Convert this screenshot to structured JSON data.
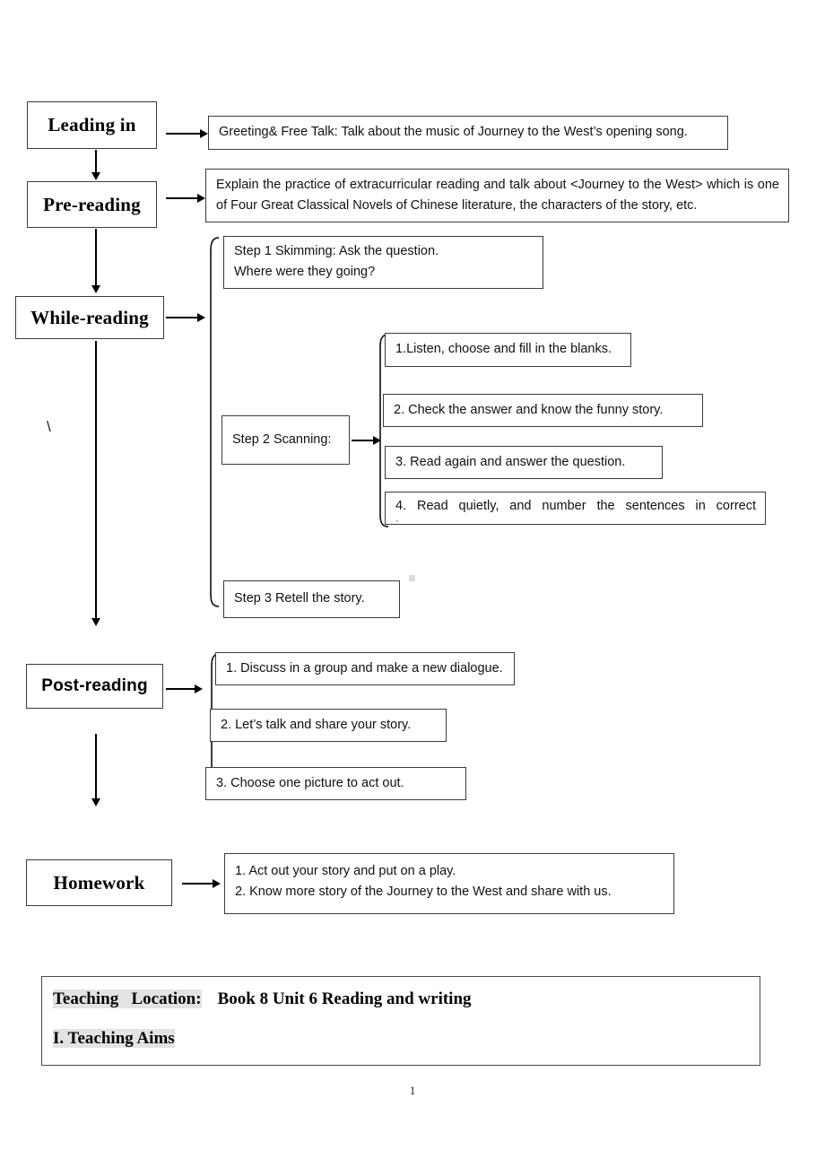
{
  "document": {
    "page_number": "1",
    "stray_mark": "\\"
  },
  "flow": {
    "stages": [
      {
        "id": "leading-in",
        "label": "Leading in"
      },
      {
        "id": "pre-reading",
        "label": "Pre-reading"
      },
      {
        "id": "while-reading",
        "label": "While-reading"
      },
      {
        "id": "post-reading",
        "label": "Post-reading"
      },
      {
        "id": "homework",
        "label": "Homework"
      }
    ],
    "leading_in": {
      "content": "Greeting& Free Talk: Talk about the music of Journey to the West’s opening song."
    },
    "pre_reading": {
      "content": "Explain the practice of extracurricular reading and talk about <Journey to the West> which is one of Four Great Classical Novels of Chinese literature, the characters of the story, etc."
    },
    "while_reading": {
      "step1": {
        "line1": "Step 1 Skimming: Ask the question.",
        "line2": "Where were they going?"
      },
      "step2": {
        "label": "Step 2 Scanning:",
        "items": [
          "1.Listen, choose and fill in the blanks.",
          "2. Check the answer and know the funny story.",
          "3. Read again and answer the question.",
          "4. Read quietly, and number the  sentences in correct"
        ],
        "item4_clipped_line": "·"
      },
      "step3": {
        "label": "Step 3 Retell the story."
      }
    },
    "post_reading": {
      "items": [
        "1. Discuss in a group and make a new dialogue.",
        "2. Let’s talk and share your story.",
        "3. Choose one picture to act out."
      ]
    },
    "homework": {
      "line1": "1. Act out your story and put on a play.",
      "line2": "2. Know more story of the Journey to the West and share with us."
    }
  },
  "teaching_block": {
    "location_label": "Teaching   Location:",
    "location_value": "Book 8 Unit 6 Reading and writing",
    "aims_heading": "I. Teaching Aims"
  }
}
